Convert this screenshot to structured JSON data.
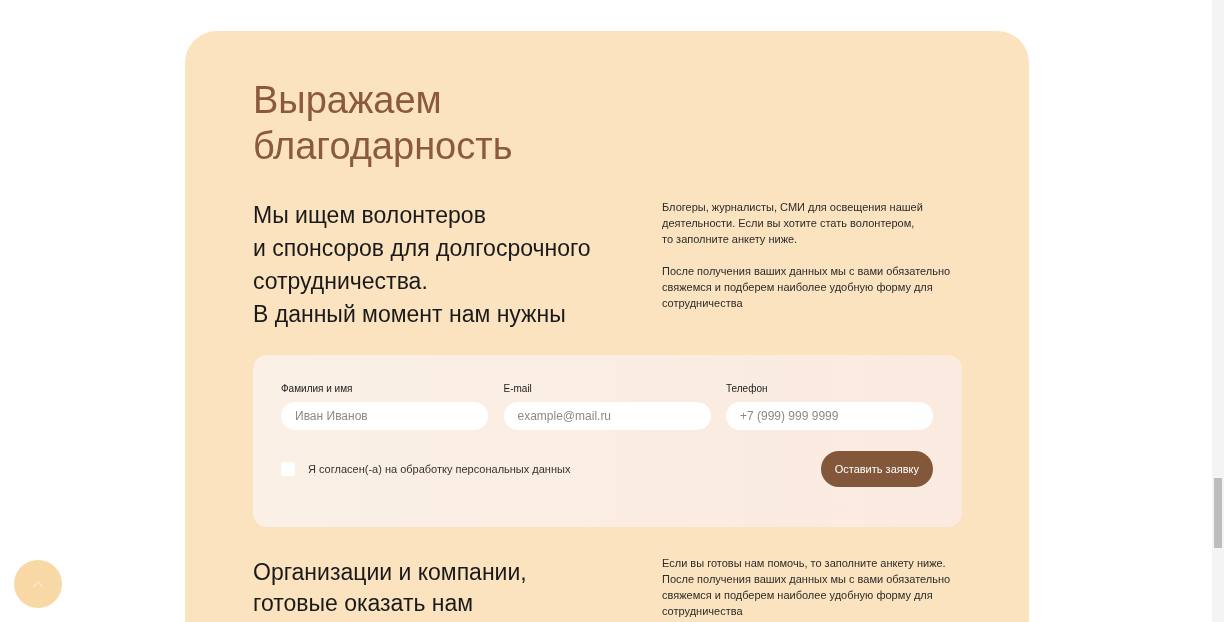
{
  "title_lines": [
    "Выражаем",
    "благодарность"
  ],
  "volunteers": {
    "heading_lines": [
      "Мы ищем волонтеров",
      "и спонсоров для долгосрочного",
      "сотрудничества.",
      "В данный момент нам нужны"
    ],
    "paragraphs": [
      [
        "Блогеры, журналисты, СМИ для освещения нашей",
        "деятельности. Если вы хотите стать волонтером,",
        "то заполните анкету ниже."
      ],
      [
        "После получения ваших данных мы с вами обязательно",
        "свяжемся и подберем наиболее удобную форму для",
        "сотрудничества"
      ]
    ]
  },
  "form": {
    "fields": [
      {
        "label": "Фамилия и имя",
        "placeholder": "Иван Иванов"
      },
      {
        "label": "E-mail",
        "placeholder": "example@mail.ru"
      },
      {
        "label": "Телефон",
        "placeholder": "+7 (999) 999 9999"
      }
    ],
    "consent": {
      "label": "Я согласен(-а) на обработку персональных данных",
      "checked": false
    },
    "submit": "Оставить заявку"
  },
  "companies": {
    "heading_lines": [
      "Организации и компании,",
      "готовые оказать нам"
    ],
    "paragraph_lines": [
      "Если вы готовы нам помочь, то заполните анкету ниже.",
      "После получения ваших данных мы с вами обязательно",
      "свяжемся и подберем наиболее удобную форму для",
      "сотрудничества"
    ]
  }
}
